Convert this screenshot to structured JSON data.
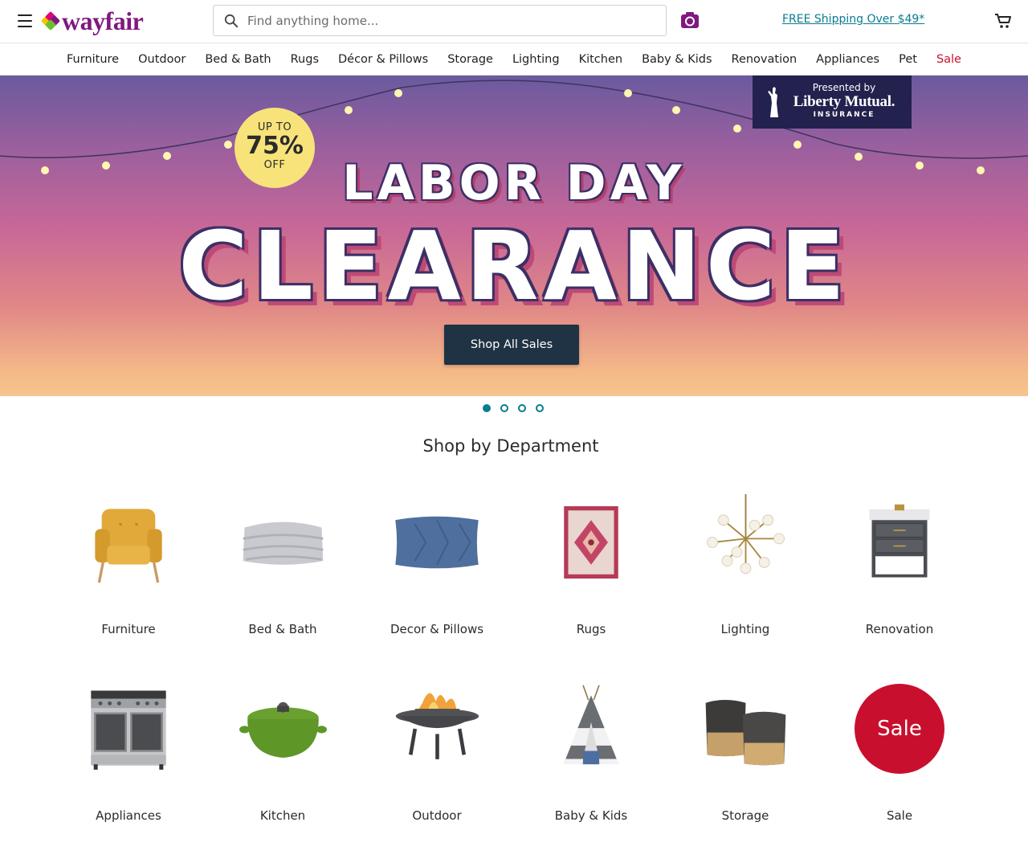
{
  "header": {
    "logo_text": "wayfair",
    "search_placeholder": "Find anything home...",
    "free_shipping": "FREE Shipping Over $49*",
    "icons": [
      "menu-icon",
      "search-icon",
      "camera-icon",
      "cart-icon"
    ]
  },
  "nav": {
    "items": [
      "Furniture",
      "Outdoor",
      "Bed & Bath",
      "Rugs",
      "Décor & Pillows",
      "Storage",
      "Lighting",
      "Kitchen",
      "Baby & Kids",
      "Renovation",
      "Appliances",
      "Pet",
      "Sale"
    ],
    "sale_color": "#c8102e"
  },
  "hero": {
    "badge_top": "UP TO",
    "badge_pct": "75%",
    "badge_bottom": "OFF",
    "line1": "LABOR DAY",
    "line2": "CLEARANCE",
    "cta": "Shop All Sales",
    "sponsor_pre": "Presented by",
    "sponsor_brand": "Liberty Mutual.",
    "sponsor_sub": "INSURANCE"
  },
  "carousel": {
    "count": 4,
    "active": 1
  },
  "departments": {
    "title": "Shop by Department",
    "items": [
      {
        "label": "Furniture",
        "icon": "armchair-icon"
      },
      {
        "label": "Bed & Bath",
        "icon": "blanket-icon"
      },
      {
        "label": "Decor & Pillows",
        "icon": "pillow-icon"
      },
      {
        "label": "Rugs",
        "icon": "rug-icon"
      },
      {
        "label": "Lighting",
        "icon": "chandelier-icon"
      },
      {
        "label": "Renovation",
        "icon": "vanity-icon"
      },
      {
        "label": "Appliances",
        "icon": "range-oven-icon"
      },
      {
        "label": "Kitchen",
        "icon": "dutch-oven-icon"
      },
      {
        "label": "Outdoor",
        "icon": "fire-pit-icon"
      },
      {
        "label": "Baby & Kids",
        "icon": "teepee-icon"
      },
      {
        "label": "Storage",
        "icon": "baskets-icon"
      },
      {
        "label": "Sale",
        "icon": "sale-circle-icon",
        "badge_text": "Sale"
      }
    ]
  },
  "colors": {
    "brand": "#7f187f",
    "teal": "#0a7c8f",
    "sale": "#c8102e",
    "cta": "#1f3344"
  }
}
